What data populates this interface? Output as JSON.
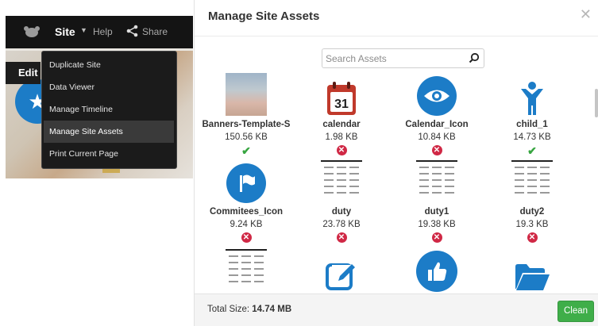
{
  "topbar": {
    "site_label": "Site",
    "help_label": "Help",
    "share_label": "Share",
    "edit_label": "Edit"
  },
  "menu": {
    "items": [
      {
        "label": "Duplicate Site"
      },
      {
        "label": "Data Viewer"
      },
      {
        "label": "Manage Timeline"
      },
      {
        "label": "Manage Site Assets",
        "active": true
      },
      {
        "label": "Print Current Page"
      }
    ]
  },
  "modal": {
    "title": "Manage Site Assets",
    "search_placeholder": "Search Assets",
    "total_label": "Total Size:",
    "total_value": "14.74 MB",
    "clean_label": "Clean"
  },
  "assets": [
    {
      "name": "Banners-Template-S",
      "size": "150.56 KB",
      "status": "ok",
      "icon": "photo-thumbnail"
    },
    {
      "name": "calendar",
      "size": "1.98 KB",
      "status": "bad",
      "icon": "calendar-icon",
      "calendar_day": "31"
    },
    {
      "name": "Calendar_Icon",
      "size": "10.84 KB",
      "status": "bad",
      "icon": "eye-icon"
    },
    {
      "name": "child_1",
      "size": "14.73 KB",
      "status": "ok",
      "icon": "child-icon"
    },
    {
      "name": "Commitees_Icon",
      "size": "9.24 KB",
      "status": "bad",
      "icon": "flag-icon"
    },
    {
      "name": "duty",
      "size": "23.78 KB",
      "status": "bad",
      "icon": "table-thumbnail"
    },
    {
      "name": "duty1",
      "size": "19.38 KB",
      "status": "bad",
      "icon": "table-thumbnail"
    },
    {
      "name": "duty2",
      "size": "19.3 KB",
      "status": "bad",
      "icon": "table-thumbnail"
    },
    {
      "name": "",
      "size": "",
      "status": "",
      "icon": "table-thumbnail"
    },
    {
      "name": "",
      "size": "",
      "status": "",
      "icon": "edit-icon"
    },
    {
      "name": "",
      "size": "",
      "status": "",
      "icon": "thumbs-up-icon"
    },
    {
      "name": "",
      "size": "",
      "status": "",
      "icon": "folder-icon"
    }
  ],
  "colors": {
    "accent_blue": "#1c7cc7",
    "ok_green": "#37a540",
    "error_red": "#d02845",
    "clean_button": "#3fae49",
    "calendar_red": "#c0392b"
  }
}
